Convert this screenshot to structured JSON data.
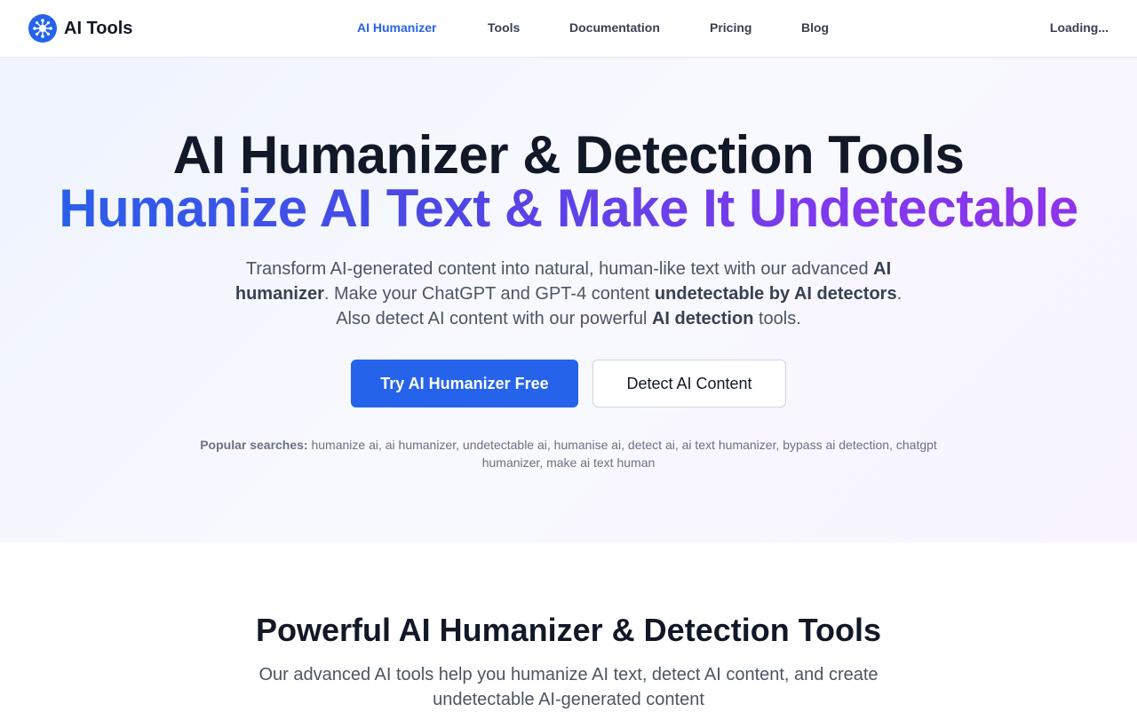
{
  "header": {
    "logo_text": "AI Tools",
    "logo_icon": "network-icon",
    "nav": [
      {
        "label": "AI Humanizer",
        "active": true
      },
      {
        "label": "Tools",
        "active": false
      },
      {
        "label": "Documentation",
        "active": false
      },
      {
        "label": "Pricing",
        "active": false
      },
      {
        "label": "Blog",
        "active": false
      }
    ],
    "status": "Loading..."
  },
  "hero": {
    "title_line1": "AI Humanizer & Detection Tools",
    "title_line2": "Humanize AI Text & Make It Undetectable",
    "desc": {
      "p1": "Transform AI-generated content into natural, human-like text with our advanced ",
      "b1": "AI humanizer",
      "p2": ". Make your ChatGPT and GPT-4 content ",
      "b2": "undetectable by AI detectors",
      "p3": ". Also detect AI content with our powerful ",
      "b3": "AI detection",
      "p4": " tools."
    },
    "primary_button": "Try AI Humanizer Free",
    "secondary_button": "Detect AI Content",
    "popular_label": "Popular searches:",
    "popular_terms": " humanize ai, ai humanizer, undetectable ai, humanise ai, detect ai, ai text humanizer, bypass ai detection, chatgpt humanizer, make ai text human"
  },
  "features": {
    "title": "Powerful AI Humanizer & Detection Tools",
    "desc": "Our advanced AI tools help you humanize AI text, detect AI content, and create undetectable AI-generated content"
  },
  "colors": {
    "accent": "#2563eb",
    "gradient_start": "#2563eb",
    "gradient_end": "#9333ea"
  }
}
